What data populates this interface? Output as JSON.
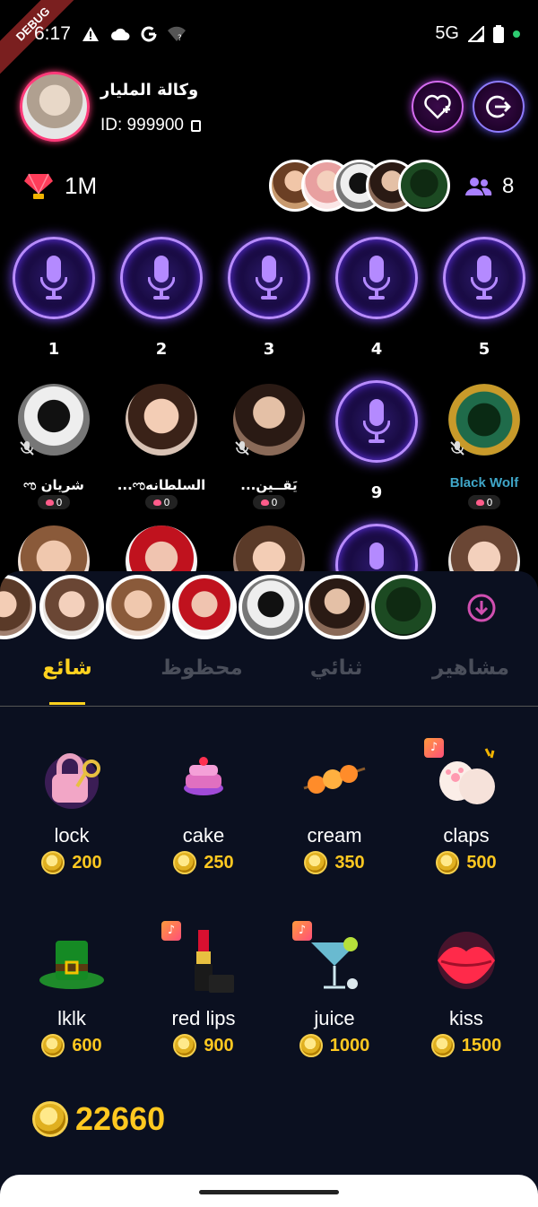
{
  "status_bar": {
    "debug_label": "DEBUG",
    "time": "6:17",
    "network": "5G"
  },
  "header": {
    "room_name": "وكالة المليار",
    "room_id": "ID: 999900"
  },
  "stats": {
    "gem_value": "1M",
    "viewer_count": "8"
  },
  "seats": [
    {
      "num": "1",
      "type": "mic"
    },
    {
      "num": "2",
      "type": "mic"
    },
    {
      "num": "3",
      "type": "mic"
    },
    {
      "num": "4",
      "type": "mic"
    },
    {
      "num": "5",
      "type": "mic"
    },
    {
      "name": "ಌ شريان",
      "badge": "0",
      "type": "user"
    },
    {
      "name": "...ಌالسلطانه",
      "badge": "0",
      "type": "user"
    },
    {
      "name": "...يَقــين",
      "badge": "0",
      "type": "user"
    },
    {
      "num": "9",
      "type": "mic"
    },
    {
      "name": "Black Wolf",
      "badge": "0",
      "type": "user"
    }
  ],
  "gift_tabs": [
    "شائع",
    "محظوظ",
    "ثنائي",
    "مشاهير"
  ],
  "gifts": [
    {
      "name": "lock",
      "price": "200"
    },
    {
      "name": "cake",
      "price": "250"
    },
    {
      "name": "cream",
      "price": "350"
    },
    {
      "name": "claps",
      "price": "500"
    },
    {
      "name": "lklk",
      "price": "600"
    },
    {
      "name": "red lips",
      "price": "900"
    },
    {
      "name": "juice",
      "price": "1000"
    },
    {
      "name": "kiss",
      "price": "1500"
    }
  ],
  "balance": "22660",
  "colors": {
    "accent_gold": "#ffc820",
    "tab_active": "#ffd21f",
    "mic_glow": "#7a4cff",
    "panel_bg": "#0b1020"
  }
}
